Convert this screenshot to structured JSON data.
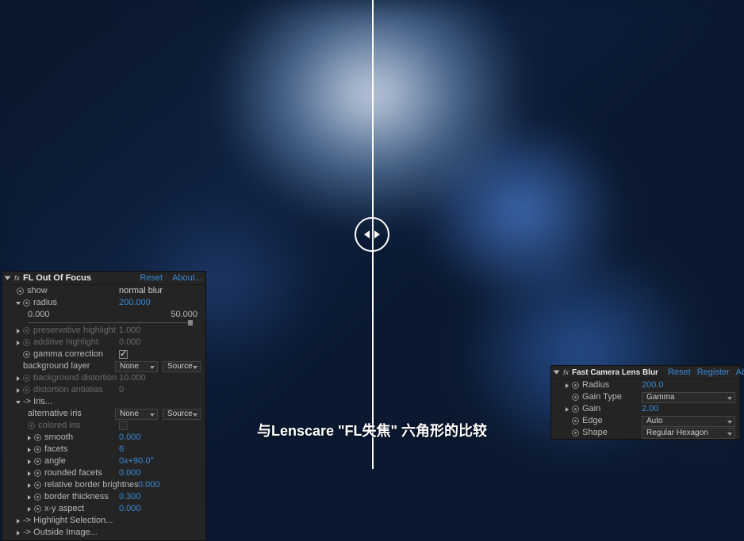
{
  "caption": "与Lenscare \"FL失焦\" 六角形的比较",
  "leftPanel": {
    "title": "FL Out Of Focus",
    "reset": "Reset",
    "about": "About...",
    "show": {
      "label": "show",
      "value": "normal blur"
    },
    "radius": {
      "label": "radius",
      "value": "200.000",
      "sliderLo": "0.000",
      "sliderHi": "50.000"
    },
    "preservHighlight": {
      "label": "preservative highlight",
      "value": "1.000"
    },
    "addHighlight": {
      "label": "additive highlight",
      "value": "0.000"
    },
    "gamma": {
      "label": "gamma correction"
    },
    "bgLayer": {
      "label": "background layer",
      "layer": "None",
      "track": "Source"
    },
    "bgDist": {
      "label": "background distortion",
      "value": "10.000"
    },
    "distAA": {
      "label": "distortion antialias",
      "value": "0"
    },
    "iris": {
      "header": "-> Iris...",
      "altIris": {
        "label": "alternative iris",
        "layer": "None",
        "track": "Source"
      },
      "coloredIris": {
        "label": "colored iris"
      },
      "smooth": {
        "label": "smooth",
        "value": "0.000"
      },
      "facets": {
        "label": "facets",
        "value": "6"
      },
      "angle": {
        "label": "angle",
        "value": "0x+90.0°"
      },
      "roundedFacets": {
        "label": "rounded facets",
        "value": "0.000"
      },
      "relBorderBright": {
        "label": "relative border brightness",
        "value": "0.000"
      },
      "borderThick": {
        "label": "border thickness",
        "value": "0.300"
      },
      "xyAspect": {
        "label": "x-y aspect",
        "value": "0.000"
      }
    },
    "highlightSel": "-> Highlight Selection...",
    "outsideImg": "-> Outside Image..."
  },
  "rightPanel": {
    "title": "Fast Camera Lens Blur",
    "reset": "Reset",
    "register": "Register",
    "about": "About...",
    "radius": {
      "label": "Radius",
      "value": "200.0"
    },
    "gainType": {
      "label": "Gain Type",
      "value": "Gamma"
    },
    "gain": {
      "label": "Gain",
      "value": "2.00"
    },
    "edge": {
      "label": "Edge",
      "value": "Auto"
    },
    "shape": {
      "label": "Shape",
      "value": "Regular Hexagon"
    }
  }
}
